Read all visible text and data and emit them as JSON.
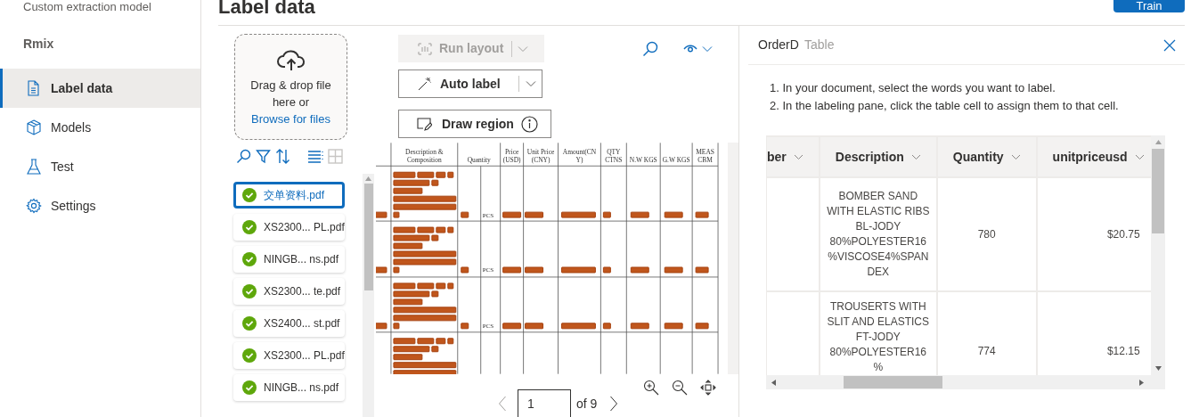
{
  "sidebar": {
    "header": "Custom extraction model",
    "project": "Rmix",
    "items": [
      {
        "label": "Label data",
        "selected": true
      },
      {
        "label": "Models",
        "selected": false
      },
      {
        "label": "Test",
        "selected": false
      },
      {
        "label": "Settings",
        "selected": false
      }
    ]
  },
  "page_title": "Label data",
  "train_button": "Train",
  "upload": {
    "text": "Drag & drop file here or",
    "link": "Browse for files"
  },
  "files": [
    {
      "name": "交单资料.pdf",
      "selected": true
    },
    {
      "name": "XS2300... PL.pdf",
      "selected": false
    },
    {
      "name": "NINGB... ns.pdf",
      "selected": false
    },
    {
      "name": "XS2300... te.pdf",
      "selected": false
    },
    {
      "name": "XS2400... st.pdf",
      "selected": false
    },
    {
      "name": "XS2300... PL.pdf",
      "selected": false
    },
    {
      "name": "NINGB... ns.pdf",
      "selected": false
    }
  ],
  "toolbar": {
    "run_layout": {
      "label": "Run layout",
      "disabled": true
    },
    "auto_label": "Auto label",
    "draw_region": "Draw region"
  },
  "document": {
    "columns": [
      [
        "Description &",
        "Composition"
      ],
      [
        "Quantity"
      ],
      [
        "Price",
        "(USD)"
      ],
      [
        "Unit Price",
        "(CNY)"
      ],
      [
        "Amount(CN",
        "Y)"
      ],
      [
        "QTY",
        "CTNS"
      ],
      [
        "N.W KGS"
      ],
      [
        "G.W KGS"
      ],
      [
        "MEAS",
        "CBM"
      ]
    ],
    "rows": [
      {
        "unit": "PCS"
      },
      {
        "unit": "PCS"
      },
      {
        "unit": "PCS"
      }
    ]
  },
  "pager": {
    "page": "1",
    "total": "of 9"
  },
  "panel": {
    "field": "OrderD",
    "type": "Table",
    "instructions": [
      "1. In your document, select the words you want to label.",
      "2. In the labeling pane, click the table cell to assign them to that cell."
    ],
    "table": {
      "columns": [
        "ber",
        "Description",
        "Quantity",
        "unitpriceusd"
      ],
      "rows": [
        {
          "description": "BOMBER SAND WITH ELASTIC RIBS BL-JODY 80%POLYESTER16%VISCOSE4%SPANDEX",
          "quantity": "780",
          "unitpriceusd": "$20.75"
        },
        {
          "description": "TROUSERTS WITH SLIT AND ELASTICS FT-JODY 80%POLYESTER16%",
          "quantity": "774",
          "unitpriceusd": "$12.15"
        }
      ]
    }
  }
}
